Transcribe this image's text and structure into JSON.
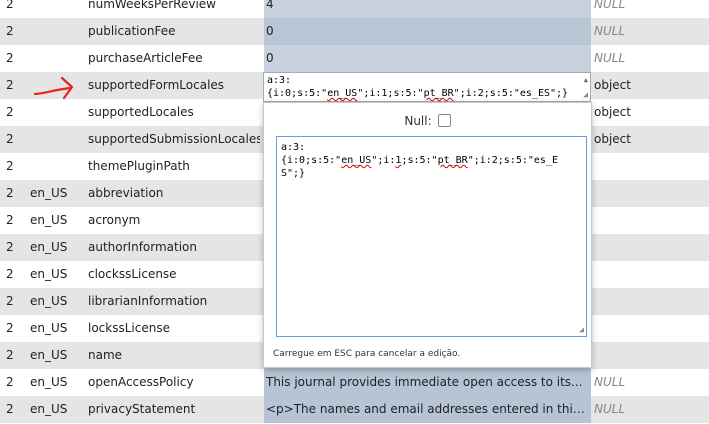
{
  "rows": [
    {
      "id": "2",
      "locale": "",
      "name": "numWeeksPerReview",
      "value": "4",
      "type": "NULL",
      "type_italic": true
    },
    {
      "id": "2",
      "locale": "",
      "name": "publicationFee",
      "value": "0",
      "type": "NULL",
      "type_italic": true
    },
    {
      "id": "2",
      "locale": "",
      "name": "purchaseArticleFee",
      "value": "0",
      "type": "NULL",
      "type_italic": true
    },
    {
      "id": "2",
      "locale": "",
      "name": "supportedFormLocales",
      "value": "",
      "type": "object",
      "type_italic": false
    },
    {
      "id": "2",
      "locale": "",
      "name": "supportedLocales",
      "value": "",
      "type": "object",
      "type_italic": false
    },
    {
      "id": "2",
      "locale": "",
      "name": "supportedSubmissionLocales",
      "value": "",
      "type": "object",
      "type_italic": false
    },
    {
      "id": "2",
      "locale": "",
      "name": "themePluginPath",
      "value": "",
      "type": "",
      "type_italic": true
    },
    {
      "id": "2",
      "locale": "en_US",
      "name": "abbreviation",
      "value": "",
      "type": "",
      "type_italic": true
    },
    {
      "id": "2",
      "locale": "en_US",
      "name": "acronym",
      "value": "",
      "type": "",
      "type_italic": true
    },
    {
      "id": "2",
      "locale": "en_US",
      "name": "authorInformation",
      "value": "",
      "type": "",
      "type_italic": true
    },
    {
      "id": "2",
      "locale": "en_US",
      "name": "clockssLicense",
      "value": "",
      "type": "",
      "type_italic": true
    },
    {
      "id": "2",
      "locale": "en_US",
      "name": "librarianInformation",
      "value": "",
      "type": "",
      "type_italic": true
    },
    {
      "id": "2",
      "locale": "en_US",
      "name": "lockssLicense",
      "value": "",
      "type": "",
      "type_italic": true
    },
    {
      "id": "2",
      "locale": "en_US",
      "name": "name",
      "value": "",
      "type": "",
      "type_italic": true
    },
    {
      "id": "2",
      "locale": "en_US",
      "name": "openAccessPolicy",
      "value": "This journal provides immediate open access to its...",
      "type": "NULL",
      "type_italic": true
    },
    {
      "id": "2",
      "locale": "en_US",
      "name": "privacyStatement",
      "value": "<p>The names and email addresses entered in this j...",
      "type": "NULL",
      "type_italic": true
    }
  ],
  "inline_editor": {
    "line1": "a:3:",
    "line2_a": "{i:0;s:5:\"",
    "line2_b": "en_US",
    "line2_c": "\";i:1;s:5:\"",
    "line2_d": "pt_BR",
    "line2_e": "\";i:2;s:5:\"es_ES\";}"
  },
  "popup": {
    "null_label": "Null:",
    "editor_line1": "a:3:",
    "editor_a": "{i:0;s:5:\"",
    "editor_b": "en_US",
    "editor_c": "\";i:",
    "editor_d": "1",
    "editor_e": ";s:5:\"",
    "editor_f": "pt_BR",
    "editor_g": "\";i:2;s:5:\"es_ES\";}",
    "hint": "Carregue em ESC para cancelar a edição."
  },
  "colors": {
    "arrow": "#e8231f",
    "row_alt": "#e5e5e5",
    "value_cell": "#b9c6d6"
  }
}
